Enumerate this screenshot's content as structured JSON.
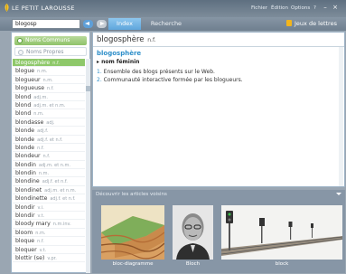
{
  "window": {
    "title": "LE PETIT LAROUSSE",
    "menu": [
      "Fichier",
      "Édition",
      "Options",
      "?"
    ]
  },
  "toolbar": {
    "search_value": "blogosp",
    "tabs": [
      "Index",
      "Recherche"
    ],
    "jeux_label": "Jeux de lettres"
  },
  "sidebar": {
    "noms_communs": "Noms Communs",
    "noms_propres": "Noms Propres",
    "words": [
      {
        "word": "blogosphère",
        "gram": "n.f."
      },
      {
        "word": "blogue",
        "gram": "n.m."
      },
      {
        "word": "blogueur",
        "gram": "n.m."
      },
      {
        "word": "blogueuse",
        "gram": "n.f."
      },
      {
        "word": "blond",
        "gram": "adj.m."
      },
      {
        "word": "blond",
        "gram": "adj.m. et n.m."
      },
      {
        "word": "blond",
        "gram": "n.m."
      },
      {
        "word": "blondasse",
        "gram": "adj."
      },
      {
        "word": "blonde",
        "gram": "adj.f."
      },
      {
        "word": "blonde",
        "gram": "adj.f. et n.f."
      },
      {
        "word": "blonde",
        "gram": "n.f."
      },
      {
        "word": "blondeur",
        "gram": "n.f."
      },
      {
        "word": "blondin",
        "gram": "adj.m. et n.m."
      },
      {
        "word": "blondin",
        "gram": "n.m."
      },
      {
        "word": "blondine",
        "gram": "adj.f. et n.f."
      },
      {
        "word": "blondinet",
        "gram": "adj.m. et n.m."
      },
      {
        "word": "blondinette",
        "gram": "adj.f. et n.f."
      },
      {
        "word": "blondir",
        "gram": "v.i."
      },
      {
        "word": "blondir",
        "gram": "v.t."
      },
      {
        "word": "bloody mary",
        "gram": "n.m.inv."
      },
      {
        "word": "bloom",
        "gram": "n.m."
      },
      {
        "word": "bloque",
        "gram": "n.f."
      },
      {
        "word": "bloquer",
        "gram": "v.t."
      },
      {
        "word": "blottir (se)",
        "gram": "v.pr."
      }
    ]
  },
  "definition": {
    "headword": "blogosphère",
    "headword_cat": "n.f.",
    "entry_word": "blogosphère",
    "grammar": "▸ nom féminin",
    "senses": [
      {
        "num": "1.",
        "text": "Ensemble des blogs présents sur le Web."
      },
      {
        "num": "2.",
        "text": "Communauté interactive formée par les blogueurs."
      }
    ]
  },
  "articles": {
    "title": "Découvrir les articles voisins",
    "captions": [
      "bloc-diagramme",
      "Bloch",
      "block"
    ]
  },
  "colors": {
    "accent_green": "#8ec86a",
    "accent_blue": "#2f8fc9",
    "tab_active": "#5fa6dc",
    "chrome": "#7d8c9a"
  }
}
